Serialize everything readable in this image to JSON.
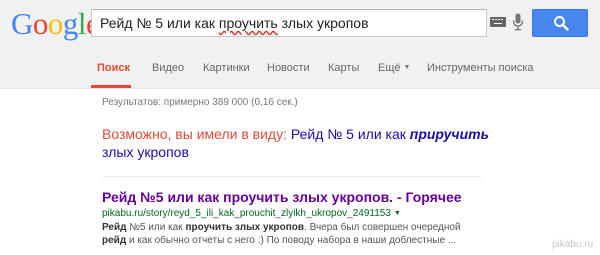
{
  "logo": {
    "text": "Google",
    "letters": [
      {
        "ch": "G",
        "color": "#4285f4"
      },
      {
        "ch": "o",
        "color": "#ea4335"
      },
      {
        "ch": "o",
        "color": "#fbbc05"
      },
      {
        "ch": "g",
        "color": "#4285f4"
      },
      {
        "ch": "l",
        "color": "#34a853"
      },
      {
        "ch": "e",
        "color": "#ea4335"
      }
    ]
  },
  "search": {
    "query_before": "Рейд № 5 или как ",
    "query_misspelled": "проучить",
    "query_after": " злых укропов"
  },
  "tabs": [
    {
      "label": "Поиск",
      "active": true
    },
    {
      "label": "Видео"
    },
    {
      "label": "Картинки"
    },
    {
      "label": "Новости"
    },
    {
      "label": "Карты"
    },
    {
      "label": "Ещё"
    },
    {
      "label": "Инструменты поиска"
    }
  ],
  "results_count": "Результатов: примерно 389 000 (0,16 сек.)",
  "did_you_mean": {
    "prefix": "Возможно, вы имели в виду: ",
    "before": "Рейд № 5 или как ",
    "corrected": "приручить",
    "after": " злых укропов"
  },
  "result": {
    "title": "Рейд №5 или как проучить злых укропов. - Горячее",
    "url": "pikabu.ru/story/reyd_5_ili_kak_prouchit_zlyikh_ukropov_2491153",
    "snippet_b1": "Рейд",
    "snippet_t1": " №5 или как ",
    "snippet_b2": "проучить злых укропов",
    "snippet_t2": ". Вчера был совершен очередной ",
    "snippet_b3": "рейд",
    "snippet_t3": " и как обычно отчеты с него :) По поводу набора в наши доблестные ..."
  },
  "watermark": "pikabu.ru",
  "colors": {
    "accent_red": "#dd4b39",
    "link_blue": "#1a0dab",
    "visited_purple": "#660099",
    "url_green": "#006621",
    "search_button": "#4787ed"
  }
}
